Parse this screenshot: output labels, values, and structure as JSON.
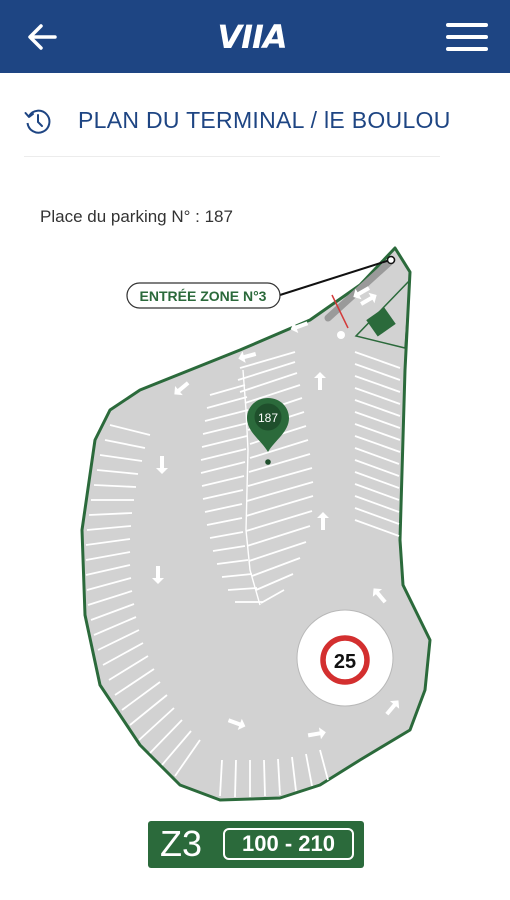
{
  "header": {
    "logo_text": "VIIA",
    "back_icon": "arrow-left-icon",
    "menu_icon": "hamburger-menu-icon",
    "background_color": "#1e4583"
  },
  "page": {
    "title": "PLAN DU TERMINAL / lE BOULOU",
    "title_icon": "history-icon",
    "title_color": "#1e4583"
  },
  "parking": {
    "label": "Place du parking N° : 187",
    "spot_number": "187"
  },
  "map": {
    "entrance_label": "ENTRÉE ZONE N°3",
    "speed_limit": "25",
    "accent_color": "#2b6a3b"
  },
  "zone": {
    "code": "Z3",
    "range": "100 - 210",
    "color": "#2b6a3b"
  }
}
